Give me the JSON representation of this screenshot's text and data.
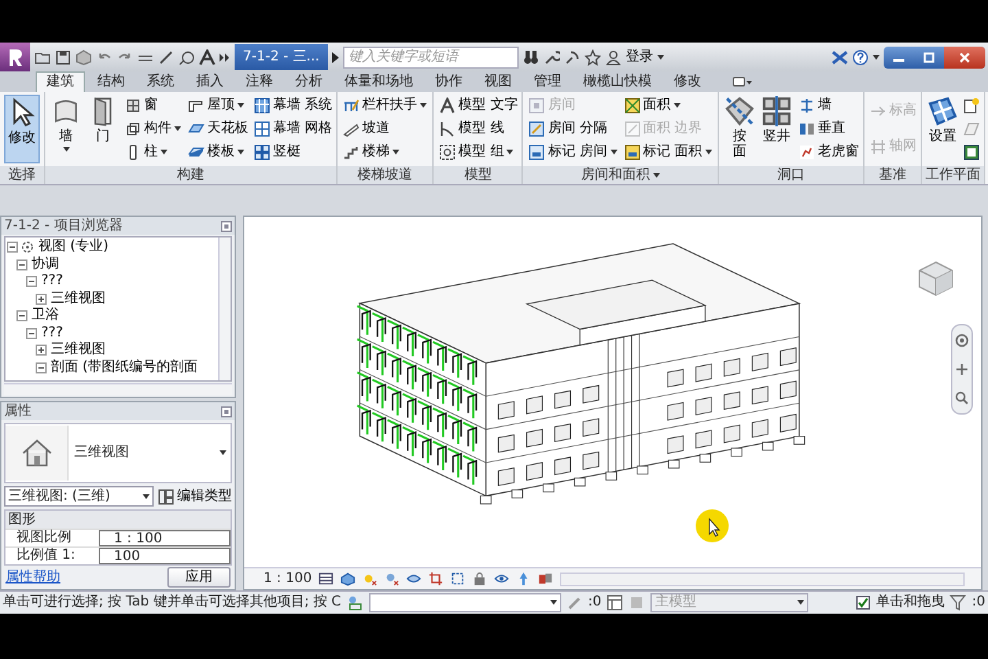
{
  "title_bar": {
    "document_title": "7-1-2 - 三...",
    "search": {
      "placeholder": "键入关键字或短语"
    },
    "sign_in": "登录"
  },
  "tabs": [
    {
      "label": "建筑",
      "selected": true
    },
    {
      "label": "结构",
      "selected": false
    },
    {
      "label": "系统",
      "selected": false
    },
    {
      "label": "插入",
      "selected": false
    },
    {
      "label": "注释",
      "selected": false
    },
    {
      "label": "分析",
      "selected": false
    },
    {
      "label": "体量和场地",
      "selected": false
    },
    {
      "label": "协作",
      "selected": false
    },
    {
      "label": "视图",
      "selected": false
    },
    {
      "label": "管理",
      "selected": false
    },
    {
      "label": "橄榄山快模",
      "selected": false
    },
    {
      "label": "修改",
      "selected": false
    }
  ],
  "ribbon": [
    {
      "label": "选择",
      "columns": [
        [
          {
            "label": "修改",
            "kind": "large",
            "active": true,
            "disabled": false,
            "dropdown": false
          }
        ]
      ]
    },
    {
      "label": "构建",
      "columns": [
        [
          {
            "label": "墙",
            "kind": "large",
            "active": false,
            "disabled": false,
            "dropdown": true
          }
        ],
        [
          {
            "label": "门",
            "kind": "large",
            "active": false,
            "disabled": false,
            "dropdown": false
          }
        ],
        [
          {
            "label": "窗",
            "kind": "small",
            "active": false,
            "disabled": false,
            "dropdown": false
          },
          {
            "label": "构件",
            "kind": "small",
            "active": false,
            "disabled": false,
            "dropdown": true
          },
          {
            "label": "柱",
            "kind": "small",
            "active": false,
            "disabled": false,
            "dropdown": true
          }
        ],
        [
          {
            "label": "屋顶",
            "kind": "small",
            "active": false,
            "disabled": false,
            "dropdown": true
          },
          {
            "label": "天花板",
            "kind": "small",
            "active": false,
            "disabled": false,
            "dropdown": false
          },
          {
            "label": "楼板",
            "kind": "small",
            "active": false,
            "disabled": false,
            "dropdown": true
          }
        ],
        [
          {
            "label": "幕墙 系统",
            "kind": "small",
            "active": false,
            "disabled": false,
            "dropdown": false
          },
          {
            "label": "幕墙 网格",
            "kind": "small",
            "active": false,
            "disabled": false,
            "dropdown": false
          },
          {
            "label": "竖梃",
            "kind": "small",
            "active": false,
            "disabled": false,
            "dropdown": false
          }
        ]
      ]
    },
    {
      "label": "楼梯坡道",
      "columns": [
        [
          {
            "label": "栏杆扶手",
            "kind": "small",
            "active": false,
            "disabled": false,
            "dropdown": true
          },
          {
            "label": "坡道",
            "kind": "small",
            "active": false,
            "disabled": false,
            "dropdown": false
          },
          {
            "label": "楼梯",
            "kind": "small",
            "active": false,
            "disabled": false,
            "dropdown": true
          }
        ]
      ]
    },
    {
      "label": "模型",
      "columns": [
        [
          {
            "label": "模型 文字",
            "kind": "small",
            "active": false,
            "disabled": false,
            "dropdown": false
          },
          {
            "label": "模型 线",
            "kind": "small",
            "active": false,
            "disabled": false,
            "dropdown": false
          },
          {
            "label": "模型 组",
            "kind": "small",
            "active": false,
            "disabled": false,
            "dropdown": true
          }
        ]
      ]
    },
    {
      "label": "房间和面积",
      "dropdown": true,
      "columns": [
        [
          {
            "label": "房间",
            "kind": "small",
            "active": false,
            "disabled": true,
            "dropdown": false
          },
          {
            "label": "房间 分隔",
            "kind": "small",
            "active": false,
            "disabled": false,
            "dropdown": false
          },
          {
            "label": "标记 房间",
            "kind": "small",
            "active": false,
            "disabled": false,
            "dropdown": true
          }
        ],
        [
          {
            "label": "面积",
            "kind": "small",
            "active": false,
            "disabled": false,
            "dropdown": true
          },
          {
            "label": "面积 边界",
            "kind": "small",
            "active": false,
            "disabled": true,
            "dropdown": false
          },
          {
            "label": "标记 面积",
            "kind": "small",
            "active": false,
            "disabled": false,
            "dropdown": true
          }
        ]
      ]
    },
    {
      "label": "洞口",
      "columns": [
        [
          {
            "label": "按面",
            "kind": "stacked",
            "active": false,
            "disabled": false,
            "dropdown": false
          }
        ],
        [
          {
            "label": "竖井",
            "kind": "large",
            "active": false,
            "disabled": false,
            "dropdown": false
          }
        ],
        [
          {
            "label": "墙",
            "kind": "small",
            "active": false,
            "disabled": false,
            "dropdown": false
          },
          {
            "label": "垂直",
            "kind": "small",
            "active": false,
            "disabled": false,
            "dropdown": false
          },
          {
            "label": "老虎窗",
            "kind": "small",
            "active": false,
            "disabled": false,
            "dropdown": false
          }
        ]
      ]
    },
    {
      "label": "基准",
      "columns": [
        [
          {
            "label": "标高",
            "kind": "small",
            "active": false,
            "disabled": true,
            "dropdown": false
          },
          {
            "label": "轴网",
            "kind": "small",
            "active": false,
            "disabled": true,
            "dropdown": false
          }
        ]
      ]
    },
    {
      "label": "工作平面",
      "columns": [
        [
          {
            "label": "设置",
            "kind": "large",
            "active": false,
            "disabled": false,
            "dropdown": false
          }
        ]
      ]
    }
  ],
  "project_browser": {
    "title": "7-1-2 - 项目浏览器",
    "tree": [
      {
        "label": "视图 (专业)",
        "expanded": true,
        "children": [
          {
            "label": "协调",
            "expanded": true,
            "children": [
              {
                "label": "???",
                "expanded": true,
                "children": [
                  {
                    "label": "三维视图",
                    "expanded": false
                  }
                ]
              }
            ]
          },
          {
            "label": "卫浴",
            "expanded": true,
            "children": [
              {
                "label": "???",
                "expanded": true,
                "children": [
                  {
                    "label": "三维视图",
                    "expanded": false
                  },
                  {
                    "label": "剖面 (带图纸编号的剖面",
                    "expanded": true
                  }
                ]
              }
            ]
          }
        ]
      }
    ]
  },
  "properties": {
    "title": "属性",
    "type_name": "三维视图",
    "view_selector": "三维视图: (三维)",
    "edit_type": "编辑类型",
    "groups": [
      {
        "label": "图形",
        "rows": [
          {
            "name": "视图比例",
            "value": "1 : 100"
          },
          {
            "name": "比例值 1:",
            "value": "100"
          }
        ]
      }
    ],
    "help_link": "属性帮助",
    "apply": "应用"
  },
  "view_control_bar": {
    "scale": "1 : 100"
  },
  "status_bar": {
    "message": "单击可进行选择; 按 Tab 键并单击可选择其他项目; 按 C",
    "selection_count": ":0",
    "design_option": "主模型",
    "click_drag": {
      "label": "单击和拖曳",
      "checked": true
    },
    "filter_count": ":0"
  }
}
